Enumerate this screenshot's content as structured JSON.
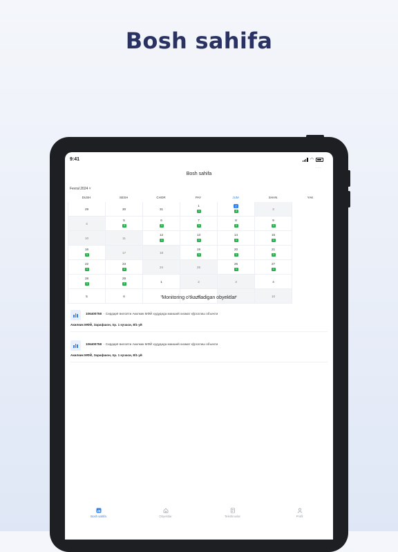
{
  "headline": "Bosh sahifa",
  "status_bar": {
    "time": "9:41"
  },
  "screen": {
    "title": "Bosh sahifa",
    "more_menu": "···",
    "month_selector": "Fevral 2024 ˅"
  },
  "calendar": {
    "weekdays": [
      "DUSH",
      "SESH",
      "CHOR",
      "PAY",
      "JUM",
      "SHAN",
      "YAK"
    ],
    "today_column": 4,
    "weeks": [
      [
        {
          "day": "29",
          "count": ""
        },
        {
          "day": "30",
          "count": ""
        },
        {
          "day": "31",
          "count": ""
        },
        {
          "day": "1",
          "count": "1"
        },
        {
          "day": "2",
          "count": "3",
          "today": true
        },
        {
          "day": "3",
          "count": ""
        },
        {
          "day": "4",
          "count": ""
        }
      ],
      [
        {
          "day": "5",
          "count": "3"
        },
        {
          "day": "6",
          "count": "1"
        },
        {
          "day": "7",
          "count": "1"
        },
        {
          "day": "8",
          "count": "1"
        },
        {
          "day": "9",
          "count": "1"
        },
        {
          "day": "10",
          "count": ""
        },
        {
          "day": "11",
          "count": ""
        }
      ],
      [
        {
          "day": "12",
          "count": "1"
        },
        {
          "day": "13",
          "count": "1"
        },
        {
          "day": "14",
          "count": "1"
        },
        {
          "day": "15",
          "count": "1"
        },
        {
          "day": "16",
          "count": "1"
        },
        {
          "day": "17",
          "count": ""
        },
        {
          "day": "18",
          "count": ""
        }
      ],
      [
        {
          "day": "19",
          "count": "1"
        },
        {
          "day": "20",
          "count": "1"
        },
        {
          "day": "21",
          "count": "1"
        },
        {
          "day": "22",
          "count": "1"
        },
        {
          "day": "23",
          "count": "1"
        },
        {
          "day": "24",
          "count": ""
        },
        {
          "day": "25",
          "count": ""
        }
      ],
      [
        {
          "day": "26",
          "count": "1"
        },
        {
          "day": "27",
          "count": "1"
        },
        {
          "day": "28",
          "count": "1"
        },
        {
          "day": "29",
          "count": "1"
        },
        {
          "day": "1",
          "count": ""
        },
        {
          "day": "2",
          "count": ""
        },
        {
          "day": "3",
          "count": ""
        }
      ],
      [
        {
          "day": "4",
          "count": ""
        },
        {
          "day": "5",
          "count": ""
        },
        {
          "day": "6",
          "count": ""
        },
        {
          "day": "7",
          "count": ""
        },
        {
          "day": "8",
          "count": ""
        },
        {
          "day": "9",
          "count": ""
        },
        {
          "day": "10",
          "count": ""
        }
      ]
    ]
  },
  "monitoring": {
    "title": "Monitoring o'tkaziladigan obyektlar",
    "objects": [
      {
        "code": "106400758",
        "description": "·  Сирдарё вилояти Акилкик МФЙ худудида маиший хизмат кўрсатиш объекти",
        "address": "Акилкик МФЙ, Зарафшон, пр. 1 кучаси, 8/1-уй"
      },
      {
        "code": "106400758",
        "description": "·  Сирдарё вилояти Акилкик МФЙ худудида маиший хизмат кўрсатиш объекти",
        "address": "Акилкик МФЙ, Зарафшон, пр. 1 кучаси, 8/1-уй"
      }
    ]
  },
  "tabs": [
    {
      "label": "Bosh sahifa",
      "icon": "chart-icon",
      "active": true
    },
    {
      "label": "Obyektlar",
      "icon": "home-icon",
      "active": false
    },
    {
      "label": "Tekshiruvlar",
      "icon": "checklist-icon",
      "active": false
    },
    {
      "label": "Profil",
      "icon": "user-icon",
      "active": false
    }
  ],
  "colors": {
    "accent": "#2f7fe6",
    "badge": "#28b04c",
    "headline": "#2a3264"
  }
}
